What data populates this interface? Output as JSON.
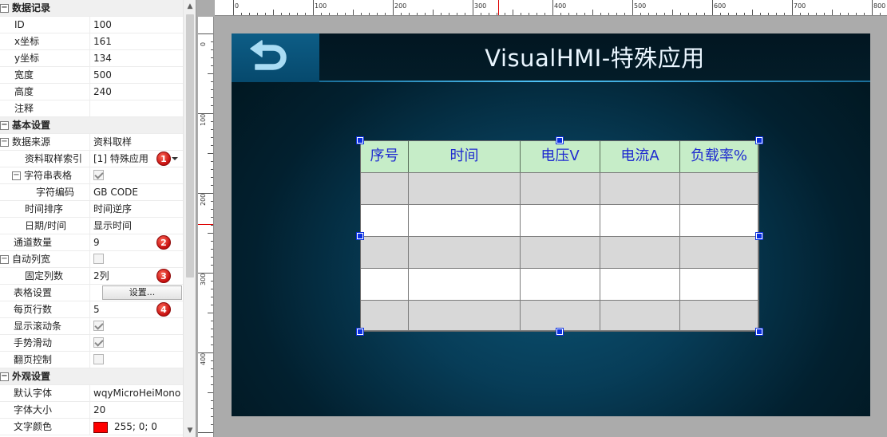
{
  "properties": {
    "sections": {
      "data_record": "数据记录",
      "basic": "基本设置",
      "appearance": "外观设置"
    },
    "rows": {
      "id": {
        "label": "ID",
        "value": "100"
      },
      "x": {
        "label": "x坐标",
        "value": "161"
      },
      "y": {
        "label": "y坐标",
        "value": "134"
      },
      "width": {
        "label": "宽度",
        "value": "500"
      },
      "height": {
        "label": "高度",
        "value": "240"
      },
      "comment": {
        "label": "注释",
        "value": ""
      },
      "data_source": {
        "label": "数据来源",
        "value": "资料取样"
      },
      "sample_index": {
        "label": "资料取样索引",
        "value": "[1] 特殊应用"
      },
      "string_table": {
        "label": "字符串表格"
      },
      "encoding": {
        "label": "字符编码",
        "value": "GB CODE"
      },
      "time_order": {
        "label": "时间排序",
        "value": "时间逆序"
      },
      "datetime": {
        "label": "日期/时间",
        "value": "显示时间"
      },
      "channel_count": {
        "label": "通道数量",
        "value": "9"
      },
      "auto_width": {
        "label": "自动列宽"
      },
      "fixed_cols": {
        "label": "固定列数",
        "value": "2列"
      },
      "table_settings": {
        "label": "表格设置",
        "button": "设置..."
      },
      "rows_per_page": {
        "label": "每页行数",
        "value": "5"
      },
      "show_scrollbar": {
        "label": "显示滚动条"
      },
      "gesture_scroll": {
        "label": "手势滑动"
      },
      "page_control": {
        "label": "翻页控制"
      },
      "default_font": {
        "label": "默认字体",
        "value": "wqyMicroHeiMono"
      },
      "font_size": {
        "label": "字体大小",
        "value": "20"
      },
      "text_color": {
        "label": "文字颜色",
        "value": "255; 0; 0"
      }
    },
    "toggles": {
      "minus": "−"
    },
    "badges": [
      "1",
      "2",
      "3",
      "4"
    ],
    "text_color_hex": "#ff0000"
  },
  "rulers": {
    "top": [
      "0",
      "100",
      "200",
      "300",
      "400",
      "500",
      "600",
      "700",
      "800"
    ],
    "left": [
      "0",
      "100",
      "200",
      "300",
      "400"
    ]
  },
  "hmi": {
    "title": "VisualHMI-特殊应用",
    "back_icon": "back-arrow-icon",
    "table": {
      "headers": [
        "序号",
        "时间",
        "电压V",
        "电流A",
        "负载率%"
      ]
    }
  },
  "colors": {
    "header_green": "#c6edc8",
    "header_text": "#1f2bd0",
    "handle_blue": "#0a2fe0"
  }
}
